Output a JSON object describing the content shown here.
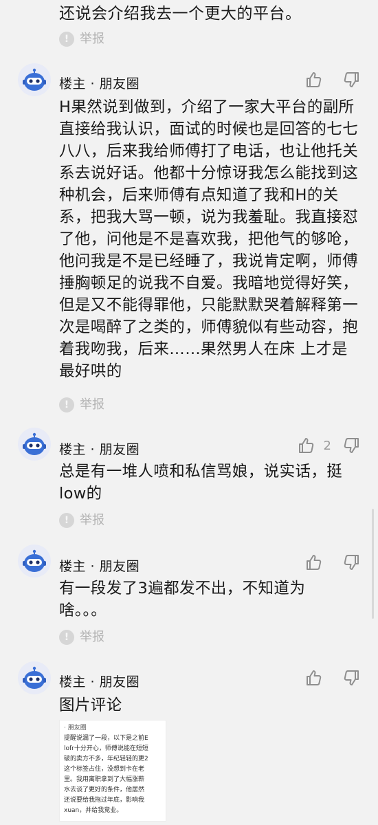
{
  "top_continued": "还说会介绍我去一个更大的平台。",
  "report_label": "举报",
  "comments": [
    {
      "author": "楼主 · 朋友圈",
      "likes": "",
      "text": "H果然说到做到，介绍了一家大平台的副所直接给我认识，面试的时候也是回答的七七八八，后来我给师傅打了电话，也让他托关系去说好话。他都十分惊讶我怎么能找到这种机会，后来师傅有点知道了我和H的关系，把我大骂一顿，说为我羞耻。我直接怼了他，问他是不是喜欢我，把他气的够呛，他问我是不是已经睡了，我说肯定啊，师傅捶胸顿足的说我不自爱。我暗地觉得好笑，但是又不能得罪他，只能默默哭着解释第一次是喝醉了之类的，师傅貌似有些动容，抱着我吻我，后来……果然男人在床 上才是最好哄的"
    },
    {
      "author": "楼主 · 朋友圈",
      "likes": "2",
      "text": "总是有一堆人喷和私信骂娘，说实话，挺low的"
    },
    {
      "author": "楼主 · 朋友圈",
      "likes": "",
      "text": "有一段发了3遍都发不出，不知道为啥。。。"
    },
    {
      "author": "楼主 · 朋友圈",
      "likes": "",
      "text": "图片评论"
    }
  ],
  "image_preview": {
    "title": "· 朋友圈",
    "lines": [
      "提醒说漏了一段，以下是之前E",
      "lofr十分开心，师傅说能在短短",
      "破的卖方不多，年纪轻轻的更2",
      "这个标签占住，没想到卡在老",
      "里。我用离职拿到了大幅涨薪",
      "水去谈了更好的条件，他居然",
      "还说要给我拖过年底，影响我",
      "xuan，并给我竞业。"
    ]
  },
  "icons": {
    "report": "report-icon",
    "like": "thumbs-up-icon",
    "dislike": "thumbs-down-icon",
    "avatar": "robot-avatar"
  },
  "colors": {
    "background": "#f2f2f2",
    "text": "#1a1a1a",
    "muted": "#b3b3b3",
    "avatar_bg": "#e8ebf7",
    "avatar_face": "#3a6fd6"
  }
}
